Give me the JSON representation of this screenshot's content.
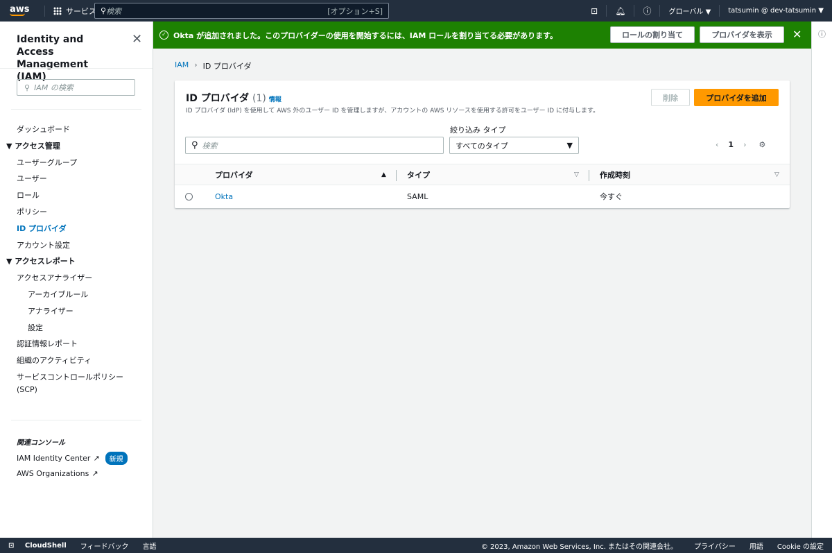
{
  "topnav": {
    "logo": "aws",
    "services": "サービス",
    "search_placeholder": "検索",
    "search_shortcut": "[オプション+S]",
    "region": "グローバル ▼",
    "account": "tatsumin @ dev-tatsumin ▼"
  },
  "sidebar": {
    "title": "Identity and Access Management (IAM)",
    "search_placeholder": "IAM の検索",
    "items": [
      {
        "label": "ダッシュボード",
        "type": "item"
      },
      {
        "label": "▼ アクセス管理",
        "type": "sec"
      },
      {
        "label": "ユーザーグループ",
        "type": "item"
      },
      {
        "label": "ユーザー",
        "type": "item"
      },
      {
        "label": "ロール",
        "type": "item"
      },
      {
        "label": "ポリシー",
        "type": "item"
      },
      {
        "label": "ID プロバイダ",
        "type": "act"
      },
      {
        "label": "アカウント設定",
        "type": "item"
      },
      {
        "label": "▼ アクセスレポート",
        "type": "sec"
      },
      {
        "label": "アクセスアナライザー",
        "type": "item"
      },
      {
        "label": "アーカイブルール",
        "type": "sub"
      },
      {
        "label": "アナライザー",
        "type": "sub"
      },
      {
        "label": "設定",
        "type": "sub"
      },
      {
        "label": "認証情報レポート",
        "type": "item"
      },
      {
        "label": "組織のアクティビティ",
        "type": "item"
      },
      {
        "label": "サービスコントロールポリシー",
        "type": "item"
      },
      {
        "label": "(SCP)",
        "type": "item"
      }
    ],
    "related": "関連コンソール",
    "identity_center": "IAM Identity Center",
    "new_badge": "新規",
    "organizations": "AWS Organizations"
  },
  "banner": {
    "message": "Okta が追加されました。このプロバイダーの使用を開始するには、IAM ロールを割り当てる必要があります。",
    "assign_role": "ロールの割り当て",
    "view_provider": "プロバイダを表示"
  },
  "breadcrumb": {
    "root": "IAM",
    "current": "ID プロバイダ"
  },
  "card": {
    "title": "ID プロバイダ",
    "count": "(1)",
    "info": "情報",
    "description": "ID プロバイダ (IdP) を使用して AWS 外のユーザー ID を管理しますが、アカウントの AWS リソースを使用する許可をユーザー ID に付与します。",
    "delete": "削除",
    "add": "プロバイダを追加",
    "search_placeholder": "検索",
    "filter_label": "絞り込み タイプ",
    "filter_value": "すべてのタイプ",
    "page": "1",
    "columns": [
      "プロバイダ",
      "タイプ",
      "作成時刻"
    ],
    "rows": [
      {
        "provider": "Okta",
        "type": "SAML",
        "created": "今すぐ"
      }
    ]
  },
  "footer": {
    "cloudshell": "CloudShell",
    "feedback": "フィードバック",
    "language": "言語",
    "copyright": "© 2023, Amazon Web Services, Inc. またはその関連会社。",
    "privacy": "プライバシー",
    "terms": "用語",
    "cookie": "Cookie の設定"
  },
  "colors": {
    "nav": "#232f3e",
    "success": "#1d8102",
    "primary": "#ec7211",
    "link": "#0073bb"
  }
}
